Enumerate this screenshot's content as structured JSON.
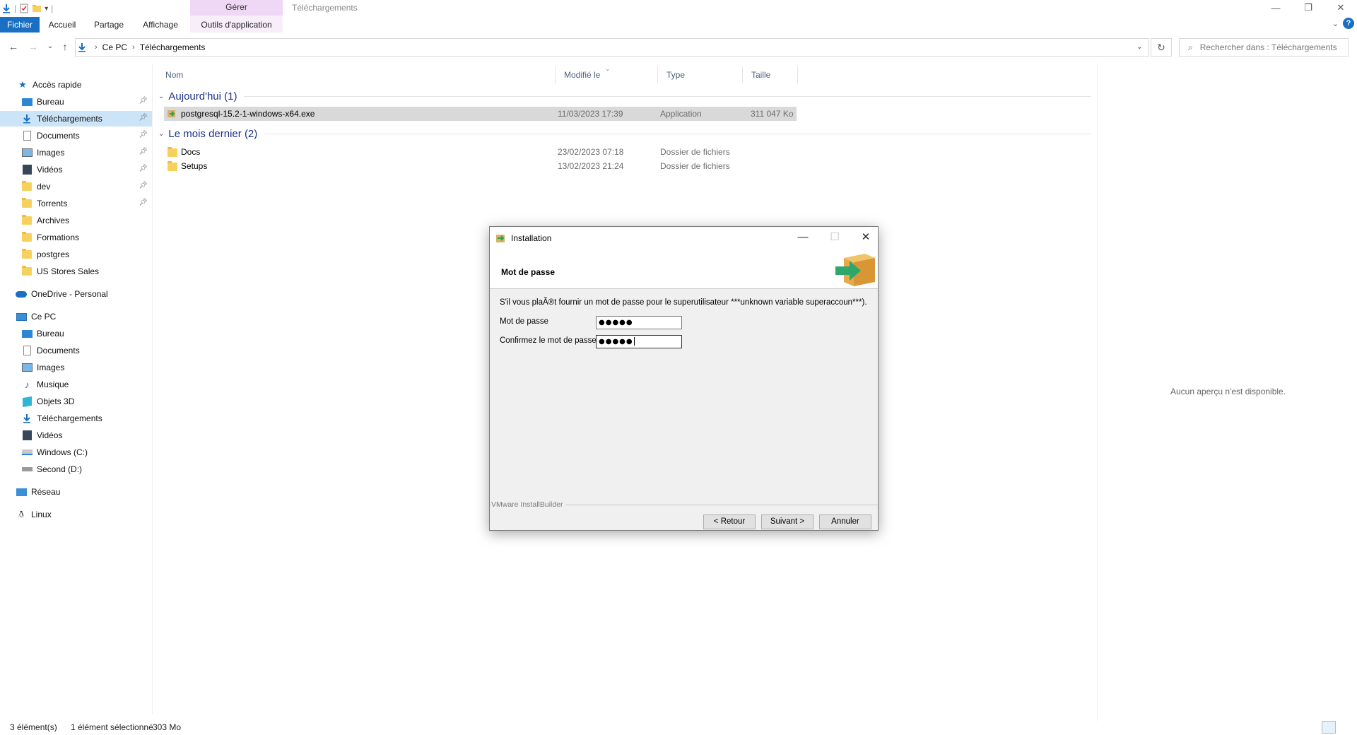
{
  "window": {
    "title": "Téléchargements",
    "context_group": "Gérer",
    "tabs": [
      "Fichier",
      "Accueil",
      "Partage",
      "Affichage",
      "Outils d'application"
    ]
  },
  "address": {
    "crumbs": [
      "Ce PC",
      "Téléchargements"
    ],
    "search_placeholder": "Rechercher dans : Téléchargements"
  },
  "nav": {
    "quick_access": "Accès rapide",
    "quick_items": [
      "Bureau",
      "Téléchargements",
      "Documents",
      "Images",
      "Vidéos",
      "dev",
      "Torrents",
      "Archives",
      "Formations",
      "postgres",
      "US Stores Sales"
    ],
    "onedrive": "OneDrive - Personal",
    "this_pc": "Ce PC",
    "pc_items": [
      "Bureau",
      "Documents",
      "Images",
      "Musique",
      "Objets 3D",
      "Téléchargements",
      "Vidéos",
      "Windows (C:)",
      "Second (D:)"
    ],
    "network": "Réseau",
    "linux": "Linux"
  },
  "columns": {
    "name": "Nom",
    "modified": "Modifié le",
    "type": "Type",
    "size": "Taille"
  },
  "groups": [
    {
      "label": "Aujourd'hui (1)"
    },
    {
      "label": "Le mois dernier (2)"
    }
  ],
  "files": [
    {
      "name": "postgresql-15.2-1-windows-x64.exe",
      "modified": "11/03/2023 17:39",
      "type": "Application",
      "size": "311 047 Ko"
    },
    {
      "name": "Docs",
      "modified": "23/02/2023 07:18",
      "type": "Dossier de fichiers",
      "size": ""
    },
    {
      "name": "Setups",
      "modified": "13/02/2023 21:24",
      "type": "Dossier de fichiers",
      "size": ""
    }
  ],
  "preview": "Aucun aperçu n'est disponible.",
  "status": {
    "count": "3 élément(s)",
    "selection": "1 élément sélectionné",
    "size": "303 Mo"
  },
  "dialog": {
    "title": "Installation",
    "heading": "Mot de passe",
    "description": "S'il vous plaÃ®t fournir un mot de passe pour le superutilisateur ***unknown variable superaccoun***).",
    "password_label": "Mot de passe",
    "password_value": "●●●●●",
    "confirm_label": "Confirmez le mot de passe.",
    "confirm_value": "●●●●●",
    "brand": "VMware InstallBuilder",
    "back": "< Retour",
    "next": "Suivant >",
    "cancel": "Annuler"
  }
}
